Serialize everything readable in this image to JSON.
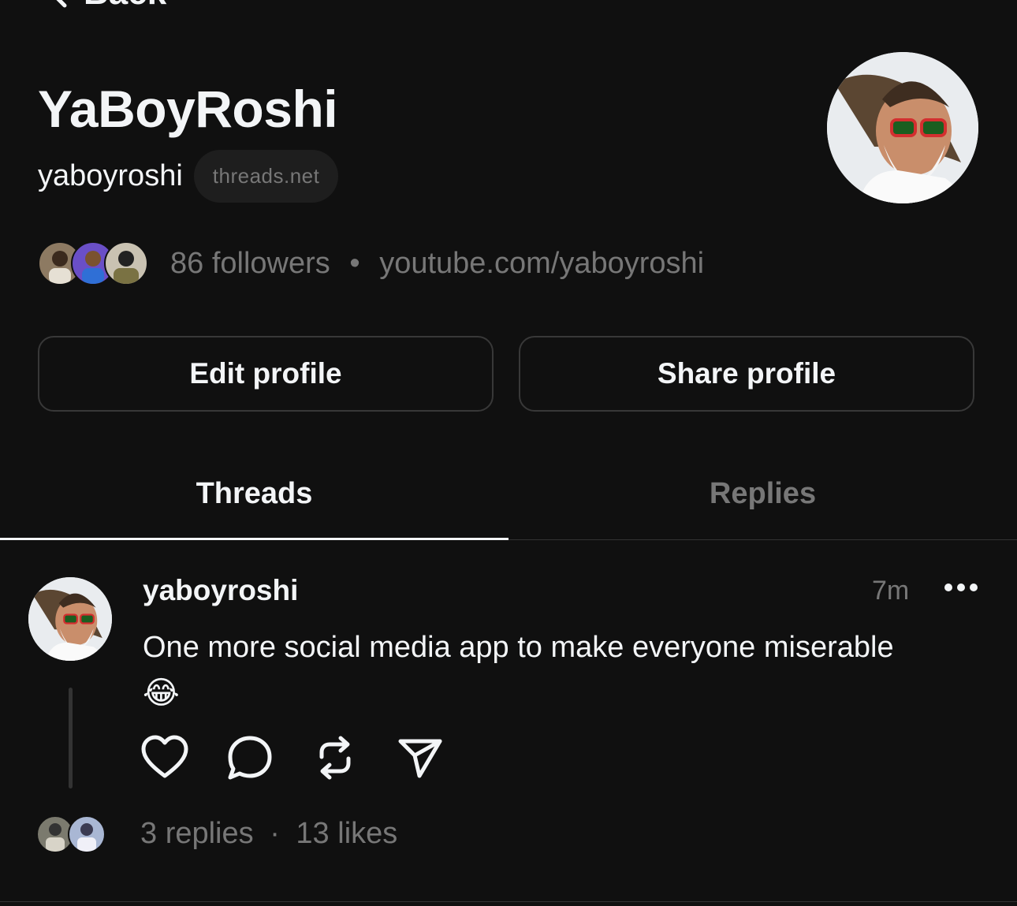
{
  "nav": {
    "back_label": "Back"
  },
  "profile": {
    "display_name": "YaBoyRoshi",
    "username": "yaboyroshi",
    "domain_badge": "threads.net",
    "followers_text": "86 followers",
    "separator": "•",
    "link": "youtube.com/yaboyroshi",
    "avatar_icon": "bearded-man-avatar"
  },
  "buttons": {
    "edit_profile": "Edit profile",
    "share_profile": "Share profile"
  },
  "tabs": [
    {
      "label": "Threads",
      "active": true
    },
    {
      "label": "Replies",
      "active": false
    }
  ],
  "post": {
    "username": "yaboyroshi",
    "time": "7m",
    "text": "One more social media app to make everyone miserable",
    "emoji": "😂",
    "replies": "3 replies",
    "stat_separator": "·",
    "likes": "13 likes",
    "actions": [
      "heart-icon",
      "comment-icon",
      "repost-icon",
      "share-icon"
    ]
  },
  "colors": {
    "background": "#101010",
    "text_primary": "#f3f5f7",
    "text_secondary": "#777777",
    "border": "#383838"
  }
}
